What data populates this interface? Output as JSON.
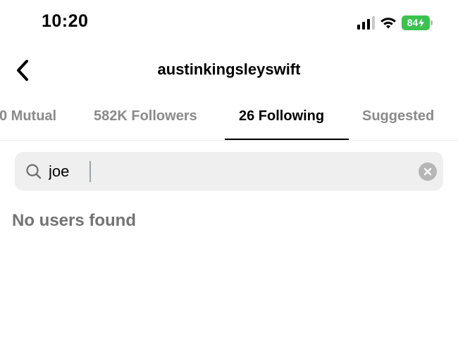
{
  "status_bar": {
    "time": "10:20",
    "battery": "84",
    "icons": [
      "cellular-signal-icon",
      "wifi-icon",
      "battery-charging-icon"
    ]
  },
  "header": {
    "back_icon": "chevron-left-icon",
    "title": "austinkingsleyswift"
  },
  "tabs": [
    {
      "label": "0 Mutual",
      "active": false
    },
    {
      "label": "582K Followers",
      "active": false
    },
    {
      "label": "26 Following",
      "active": true
    },
    {
      "label": "Suggested",
      "active": false
    }
  ],
  "search": {
    "value": "joe",
    "icon": "search-icon",
    "clear_icon": "clear-icon"
  },
  "results": {
    "empty_message": "No users found"
  },
  "colors": {
    "battery": "#3bc24f",
    "search_bg": "#efefef",
    "inactive_tab": "#8a8a8a",
    "empty_text": "#737373"
  }
}
